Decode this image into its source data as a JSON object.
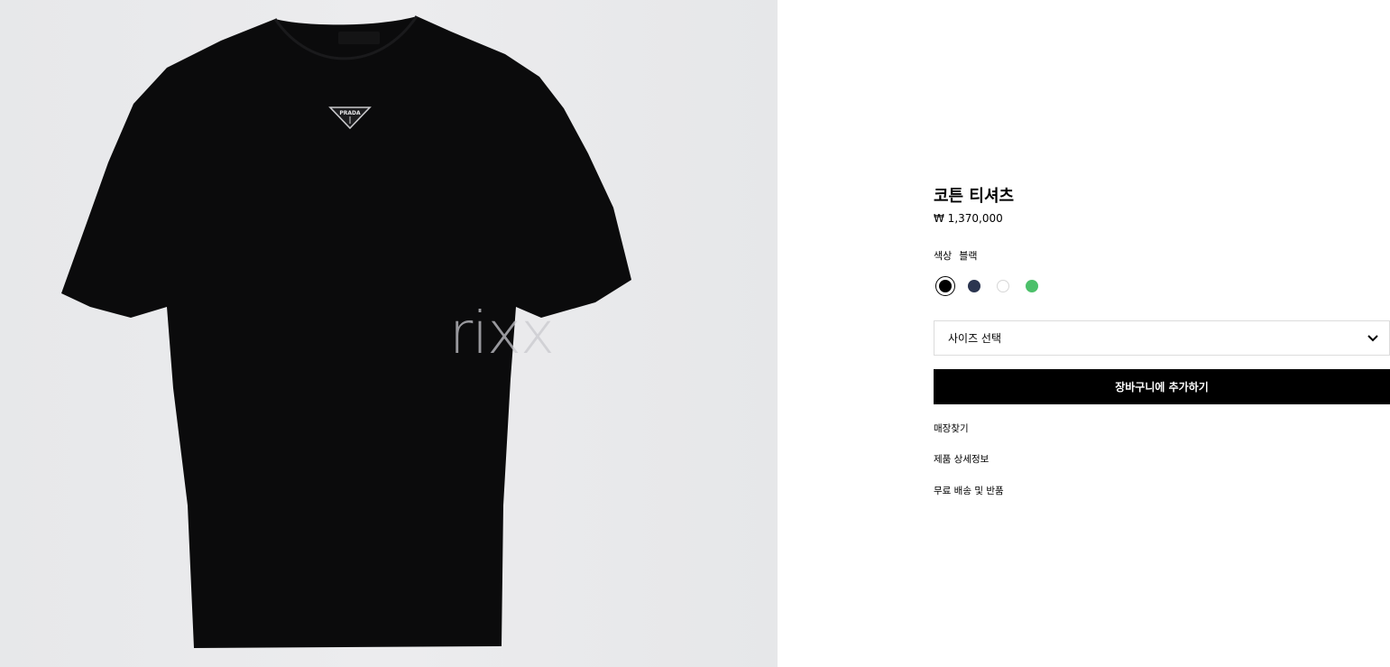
{
  "product": {
    "title": "코튼 티셔츠",
    "price": "₩ 1,370,000",
    "image_alt": "black cotton t-shirt with triangle logo",
    "logo_text": "PRADA",
    "watermark": "rixx"
  },
  "color": {
    "label": "색상",
    "selected_name": "블랙",
    "swatches": [
      {
        "name": "black",
        "hex": "#000000",
        "selected": true
      },
      {
        "name": "navy",
        "hex": "#2b3550",
        "selected": false
      },
      {
        "name": "white",
        "hex": "#ffffff",
        "selected": false
      },
      {
        "name": "green",
        "hex": "#4cc06a",
        "selected": false
      }
    ]
  },
  "size_select": {
    "placeholder": "사이즈 선택"
  },
  "cart": {
    "button_label": "장바구니에 추가하기"
  },
  "links": [
    {
      "label": "매장찾기"
    },
    {
      "label": "제품 상세정보"
    },
    {
      "label": "무료 배송 및 반품"
    }
  ],
  "colors": {
    "image_bg": "#e9eaec",
    "shirt": "#0b0b0c",
    "button_bg": "#000000",
    "border": "#dcdcdc"
  }
}
